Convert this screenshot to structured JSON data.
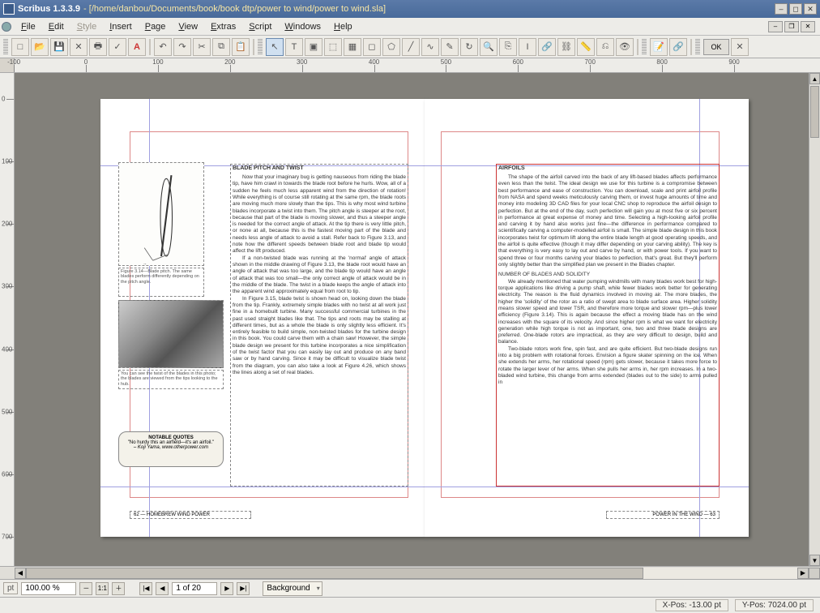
{
  "titlebar": {
    "app": "Scribus 1.3.3.9",
    "doc_path": "- [/home/danbou/Documents/book/book dtp/power to wind/power to wind.sla]"
  },
  "menubar": {
    "items": [
      "File",
      "Edit",
      "Style",
      "Insert",
      "Page",
      "View",
      "Extras",
      "Script",
      "Windows",
      "Help"
    ]
  },
  "toolbar": {
    "ok_label": "OK"
  },
  "ruler_h": {
    "ticks": [
      "-100",
      "0",
      "100",
      "200",
      "300",
      "400",
      "500",
      "600",
      "700",
      "800",
      "900"
    ]
  },
  "ruler_v": {
    "ticks": [
      "0",
      "100",
      "200",
      "300",
      "400",
      "500",
      "600",
      "700"
    ]
  },
  "left_page": {
    "heading": "BLADE PITCH AND TWIST",
    "para1": "Now that your imaginary bug is getting nauseous from riding the blade tip, have him crawl in towards the blade root before he hurls. Wow, all of a sudden he feels much less apparent wind from the direction of rotation! While everything is of course still rotating at the same rpm, the blade roots are moving much more slowly than the tips. This is why most wind turbine blades incorporate a twist into them. The pitch angle is steeper at the root, because that part of the blade is moving slower, and thus a steeper angle is needed for the correct angle of attack. At the tip there is very little pitch, or none at all, because this is the fastest moving part of the blade and needs less angle of attack to avoid a stall. Refer back to Figure 3.13, and note how the different speeds between blade root and blade tip would affect the lift produced.",
    "para2": "If a non-twisted blade was running at the 'normal' angle of attack shown in the middle drawing of Figure 3.13, the blade root would have an angle of attack that was too large, and the blade tip would have an angle of attack that was too small—the only correct angle of attack would be in the middle of the blade. The twist in a blade keeps the angle of attack into the apparent wind approximately equal from root to tip.",
    "para3": "In Figure 3.15, blade twist is shown head on, looking down the blade from the tip. Frankly, extremely simple blades with no twist at all work just fine in a homebuilt turbine. Many successful commercial turbines in the past used straight blades like that. The tips and roots may be stalling at different times, but as a whole the blade is only slightly less efficient. It's entirely feasible to build simple, non-twisted blades for the turbine design in this book. You could carve them with a chain saw! However, the simple blade design we present for this turbine incorporates a nice simplification of the twist factor that you can easily lay out and produce on any band saw or by hand carving. Since it may be difficult to visualize blade twist from the diagram, you can also take a look at Figure 4.26, which shows the lines along a set of real blades.",
    "caption1": "Figure 3.14—Blade pitch. The same blades perform differently depending on the pitch angle.",
    "caption2": "You can see the twist of the blades in this photo; the blades are viewed from the tips looking to the hub.",
    "quote_heading": "NOTABLE QUOTES",
    "quote_body": "\"No hurdy this an airfield—it's an airfoil.\"",
    "quote_src": "– Koji Yama, www.otherpower.com",
    "footer": "62 — HOMEBREW WIND POWER"
  },
  "right_page": {
    "heading": "AIRFOILS",
    "para1": "The shape of the airfoil carved into the back of any lift-based blades affects performance even less than the twist. The ideal design we use for this turbine is a compromise between best performance and ease of construction. You can download, scale and print airfoil profile from NASA and spend weeks meticulously carving them, or invest huge amounts of time and money into modeling 3D CAD files for your local CNC shop to reproduce the airfoil design to perfection. But at the end of the day, such perfection will gain you at most five or six percent in performance at great expense of money and time. Selecting a high-looking airfoil profile and carving it by hand also works just fine—the difference in performance compared to scientifically carving a computer-modelled airfoil is small. The simple blade design in this book incorporates twist for optimum lift along the entire blade length at good operating speeds, and the airfoil is quite effective (though it may differ depending on your carving ability). The key is that everything is very easy to lay out and carve by hand, or with power tools. If you want to spend three or four months carving your blades to perfection, that's great. But they'll perform only slightly better than the simplified plan we present in the Blades chapter.",
    "sub1": "NUMBER OF BLADES AND SOLIDITY",
    "para2": "We already mentioned that water pumping windmills with many blades work best for high-torque applications like driving a pump shaft, while fewer blades work better for generating electricity. The reason is the fluid dynamics involved in moving air. The more blades, the higher the 'solidity' of the rotor as a ratio of swept area to blade surface area. Higher solidity means slower speed and lower TSR, and therefore more torque and slower rpm—plus lower efficiency (Figure 3.14). This is again because the effect a moving blade has on the wind increases with the square of its velocity. And since higher rpm is what we want for electricity generation while high torque is not as important, one, two and three blade designs are preferred. One-blade rotors are impractical, as they are very difficult to design, build and balance.",
    "para3": "Two-blade rotors work fine, spin fast, and are quite efficient. But two-blade designs run into a big problem with rotational forces. Envision a figure skater spinning on the ice. When she extends her arms, her rotational speed (rpm) gets slower, because it takes more force to rotate the larger lever of her arms. When she pulls her arms in, her rpm increases. In a two-bladed wind turbine, this change from arms extended (blades out to the side) to arms pulled in",
    "footer": "POWER IN THE WIND — 63"
  },
  "statusbar": {
    "zoom": "100.00 %",
    "page_of": "1 of 20",
    "layer": "Background"
  },
  "coords": {
    "x_label": "X-Pos:",
    "x_value": "-13.00 pt",
    "y_label": "Y-Pos:",
    "y_value": "7024.00 pt"
  },
  "icons": {
    "new": "□",
    "open": "📂",
    "save": "💾",
    "close": "✕",
    "print": "🖶",
    "pdf": "A",
    "preflight": "✓",
    "undo": "↶",
    "redo": "↷",
    "cut": "✂",
    "copy": "⧉",
    "paste": "📋",
    "pointer": "↖",
    "edit": "I",
    "text": "T",
    "image": "▣",
    "render": "⬚",
    "table": "▦",
    "shape": "◻",
    "poly": "⬠",
    "line": "╱",
    "bez": "∿",
    "freehand": "✎",
    "rotate": "↻",
    "zoomin": "＋",
    "zoomout": "－",
    "zoom": "🔍",
    "contents": "⎘",
    "link": "🔗",
    "unlink": "⛓",
    "measure": "📏",
    "copyprop": "⎌",
    "eye": "👁",
    "annot": "📝",
    "linkpdf": "🔗"
  }
}
